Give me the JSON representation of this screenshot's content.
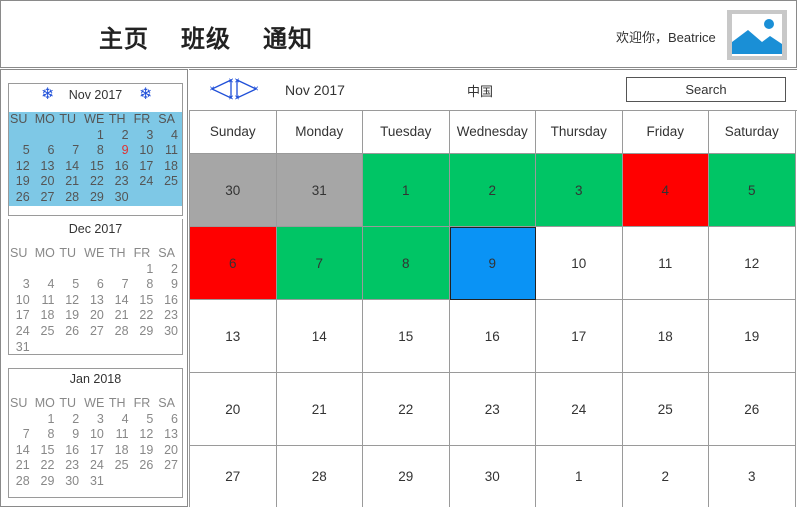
{
  "header": {
    "nav": [
      "主页",
      "班级",
      "通知"
    ],
    "welcome": "欢迎你，Beatrice"
  },
  "sidebar": {
    "calendars": [
      {
        "title": "Nov  2017",
        "has_arrows": true,
        "weekdays": [
          "SU",
          "MO",
          "TU",
          "WE",
          "TH",
          "FR",
          "SA"
        ],
        "days": [
          "",
          "",
          "",
          "1",
          "2",
          "3",
          "4",
          "5",
          "6",
          "7",
          "8",
          "9",
          "10",
          "11",
          "12",
          "13",
          "14",
          "15",
          "16",
          "17",
          "18",
          "19",
          "20",
          "21",
          "22",
          "23",
          "24",
          "25",
          "26",
          "27",
          "28",
          "29",
          "30",
          "",
          ""
        ],
        "highlight": "9"
      },
      {
        "title": "Dec 2017",
        "has_arrows": false,
        "weekdays": [
          "SU",
          "MO",
          "TU",
          "WE",
          "TH",
          "FR",
          "SA"
        ],
        "days": [
          "",
          "",
          "",
          "",
          "",
          "1",
          "2",
          "3",
          "4",
          "5",
          "6",
          "7",
          "8",
          "9",
          "10",
          "11",
          "12",
          "13",
          "14",
          "15",
          "16",
          "17",
          "18",
          "19",
          "20",
          "21",
          "22",
          "23",
          "24",
          "25",
          "26",
          "27",
          "28",
          "29",
          "30",
          "31",
          "",
          "",
          "",
          "",
          "",
          ""
        ],
        "highlight": ""
      },
      {
        "title": "Jan  2018",
        "has_arrows": false,
        "weekdays": [
          "SU",
          "MO",
          "TU",
          "WE",
          "TH",
          "FR",
          "SA"
        ],
        "days": [
          "",
          "1",
          "2",
          "3",
          "4",
          "5",
          "6",
          "7",
          "8",
          "9",
          "10",
          "11",
          "12",
          "13",
          "14",
          "15",
          "16",
          "17",
          "18",
          "19",
          "20",
          "21",
          "22",
          "23",
          "24",
          "25",
          "26",
          "27",
          "28",
          "29",
          "30",
          "31",
          "",
          "",
          ""
        ],
        "highlight": ""
      }
    ]
  },
  "main": {
    "month_label": "Nov  2017",
    "country": "中国",
    "search_label": "Search",
    "weekdays": [
      "Sunday",
      "Monday",
      "Tuesday",
      "Wednesday",
      "Thursday",
      "Friday",
      "Saturday"
    ],
    "days": [
      {
        "d": "30",
        "c": "gray"
      },
      {
        "d": "31",
        "c": "gray"
      },
      {
        "d": "1",
        "c": "green"
      },
      {
        "d": "2",
        "c": "green"
      },
      {
        "d": "3",
        "c": "green"
      },
      {
        "d": "4",
        "c": "red"
      },
      {
        "d": "5",
        "c": "green"
      },
      {
        "d": "6",
        "c": "red"
      },
      {
        "d": "7",
        "c": "green"
      },
      {
        "d": "8",
        "c": "green"
      },
      {
        "d": "9",
        "c": "blue"
      },
      {
        "d": "10",
        "c": ""
      },
      {
        "d": "11",
        "c": ""
      },
      {
        "d": "12",
        "c": ""
      },
      {
        "d": "13",
        "c": ""
      },
      {
        "d": "14",
        "c": ""
      },
      {
        "d": "15",
        "c": ""
      },
      {
        "d": "16",
        "c": ""
      },
      {
        "d": "17",
        "c": ""
      },
      {
        "d": "18",
        "c": ""
      },
      {
        "d": "19",
        "c": ""
      },
      {
        "d": "20",
        "c": ""
      },
      {
        "d": "21",
        "c": ""
      },
      {
        "d": "22",
        "c": ""
      },
      {
        "d": "23",
        "c": ""
      },
      {
        "d": "24",
        "c": ""
      },
      {
        "d": "25",
        "c": ""
      },
      {
        "d": "26",
        "c": ""
      },
      {
        "d": "27",
        "c": ""
      },
      {
        "d": "28",
        "c": ""
      },
      {
        "d": "29",
        "c": ""
      },
      {
        "d": "30",
        "c": ""
      },
      {
        "d": "1",
        "c": ""
      },
      {
        "d": "2",
        "c": ""
      },
      {
        "d": "3",
        "c": ""
      }
    ]
  },
  "icons": {
    "avatar": "image-placeholder-icon",
    "mini_prev": "snowflake-prev-icon",
    "mini_next": "snowflake-next-icon",
    "cal_prev": "triangle-left-icon",
    "cal_next": "triangle-right-icon"
  },
  "colors": {
    "mini_highlight_bg": "#7ec8e6",
    "past_day": "#a6a6a6",
    "green_status": "#00c565",
    "red_status": "#ff0000",
    "selected_day": "#0a93f5",
    "today_text": "#e03030",
    "avatar_bg": "#c8c8c8",
    "avatar_icon": "#1a8fd6"
  }
}
